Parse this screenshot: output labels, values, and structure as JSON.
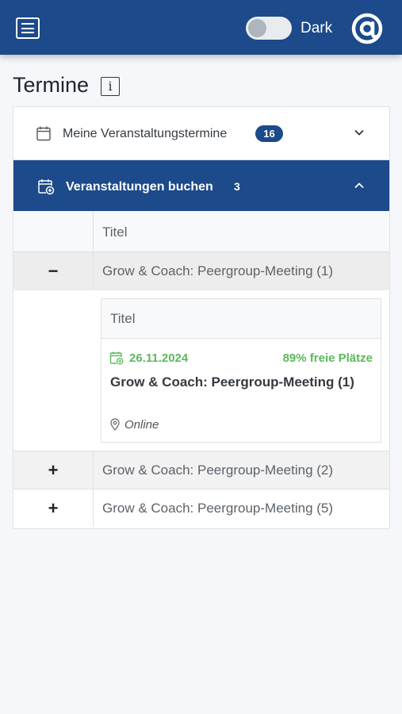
{
  "header": {
    "menu_icon": "hamburger-menu-icon",
    "theme_toggle_label": "Dark",
    "logo_icon": "at-sign-logo-icon",
    "brand_color": "#1c4a8a"
  },
  "page": {
    "title": "Termine",
    "info_icon": "i"
  },
  "accordion": {
    "my_dates": {
      "label": "Meine Veranstaltungstermine",
      "count": "16",
      "icon": "calendar-icon",
      "expanded": false
    },
    "booking": {
      "label": "Veranstaltungen buchen",
      "count": "3",
      "icon": "calendar-plus-icon",
      "expanded": true
    }
  },
  "table": {
    "column_header": "Titel",
    "rows": [
      {
        "toggle": "−",
        "title": "Grow & Coach: Peergroup-Meeting (1)",
        "expanded": true
      },
      {
        "toggle": "+",
        "title": "Grow & Coach: Peergroup-Meeting (2)",
        "expanded": false
      },
      {
        "toggle": "+",
        "title": "Grow & Coach: Peergroup-Meeting (5)",
        "expanded": false
      }
    ],
    "detail": {
      "column_header": "Titel",
      "date": "26.11.2024",
      "free_places": "89% freie Plätze",
      "title": "Grow & Coach: Peergroup-Meeting (1)",
      "location": "Online",
      "accent_color": "#5cb85c"
    }
  }
}
